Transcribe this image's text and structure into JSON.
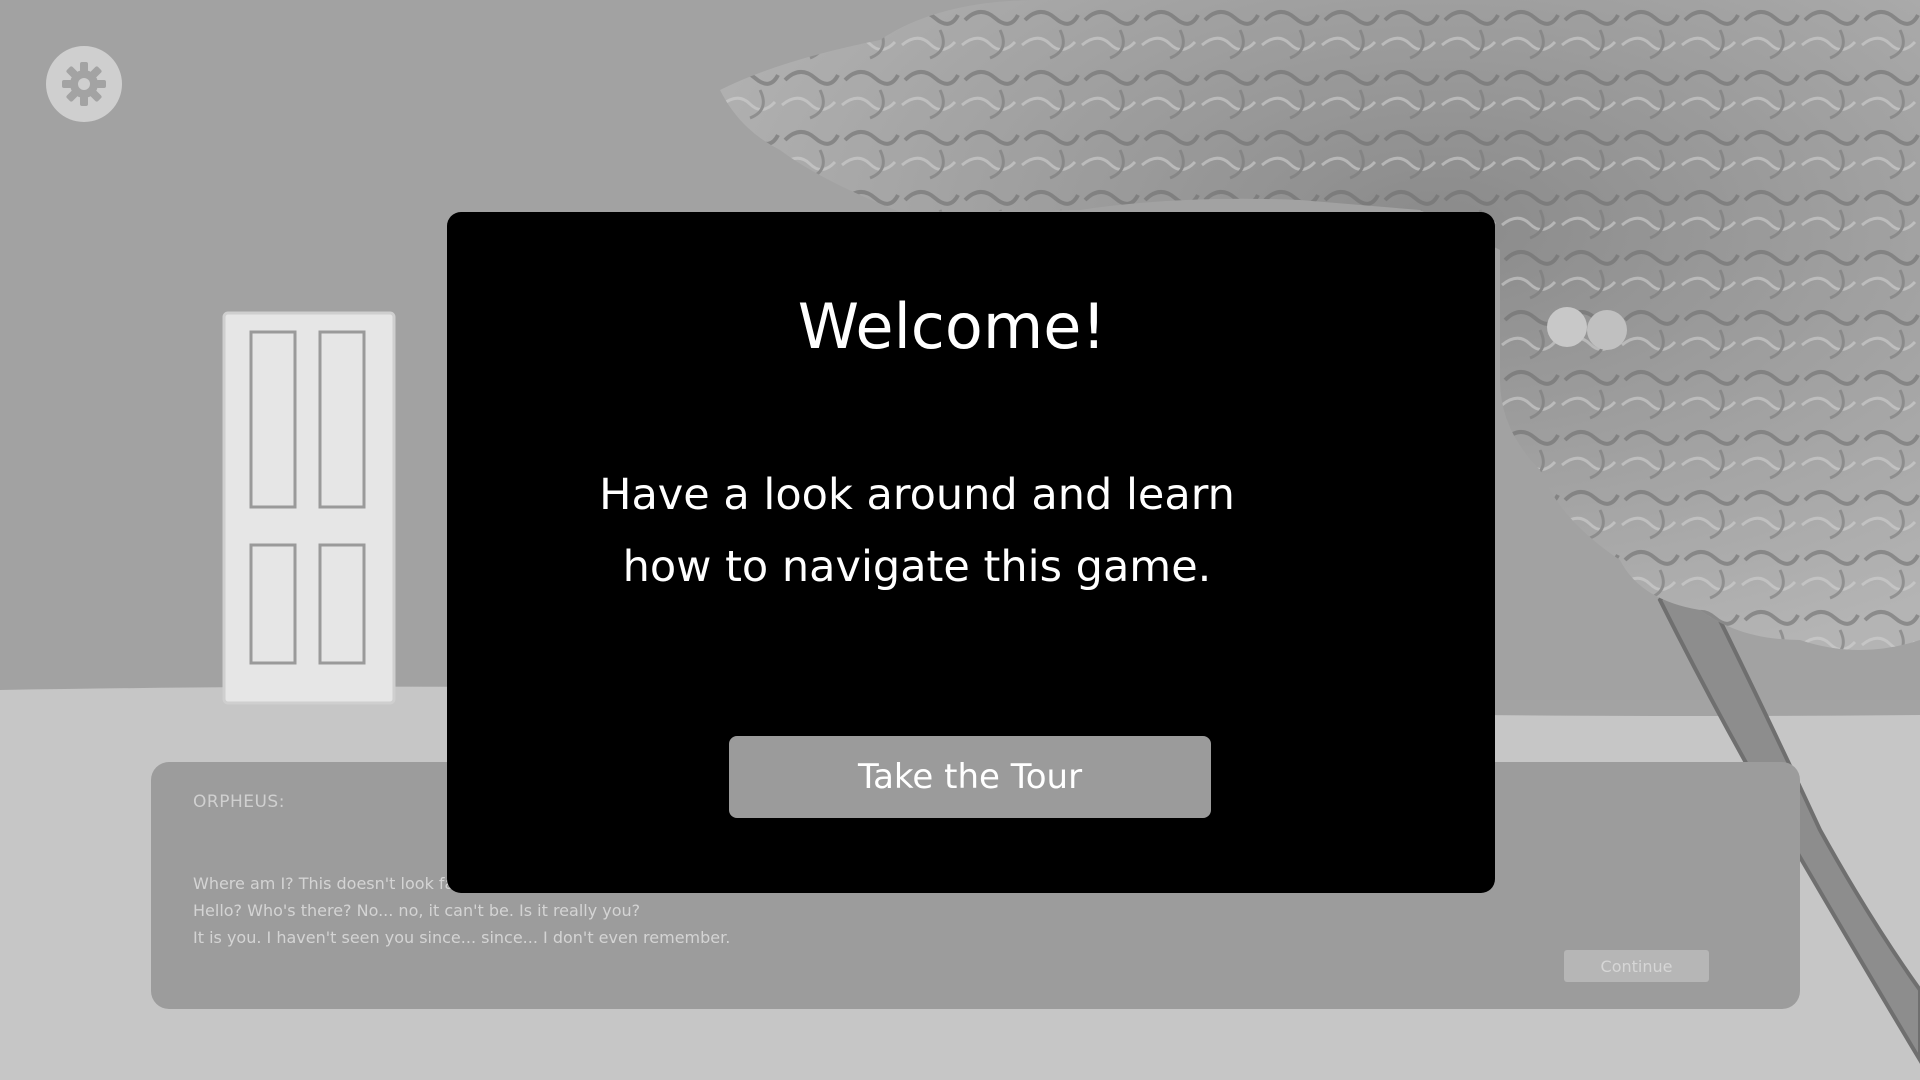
{
  "settings": {
    "icon": "gear-icon"
  },
  "dialogue": {
    "speaker": "ORPHEUS:",
    "lines": [
      "Where am I? This doesn't look fami",
      "Hello? Who's there? No... no, it can't be. Is it really you?",
      "It is you. I haven't seen you since... since... I don't even remember."
    ],
    "continue_label": "Continue"
  },
  "modal": {
    "title": "Welcome!",
    "message": "Have a look around and learn how to navigate this game.",
    "button_label": "Take the Tour"
  },
  "colors": {
    "modal_background": "#000000",
    "button_background": "#9b9b9b",
    "scene_wall": "#a3a3a3",
    "scene_floor": "#c4c4c4"
  }
}
